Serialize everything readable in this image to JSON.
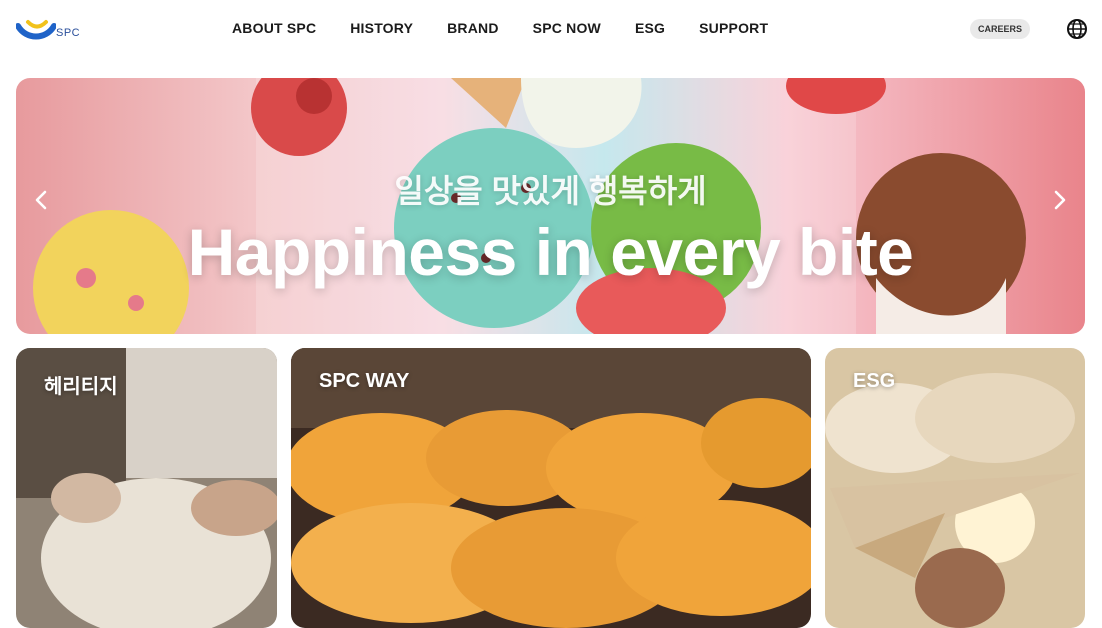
{
  "header": {
    "logo_text": "SPC",
    "nav": [
      "ABOUT SPC",
      "HISTORY",
      "BRAND",
      "SPC NOW",
      "ESG",
      "SUPPORT"
    ],
    "careers_label": "CAREERS"
  },
  "hero": {
    "korean_tagline": "일상을 맛있게 행복하게",
    "headline": "Happiness in every bite"
  },
  "cards": [
    {
      "label": "헤리티지"
    },
    {
      "label": "SPC WAY"
    },
    {
      "label": "ESG"
    }
  ],
  "colors": {
    "brand_blue": "#1f63c8",
    "brand_yellow": "#f1c21b"
  },
  "icons": {
    "globe": "globe-icon",
    "prev": "chevron-left-icon",
    "next": "chevron-right-icon"
  }
}
